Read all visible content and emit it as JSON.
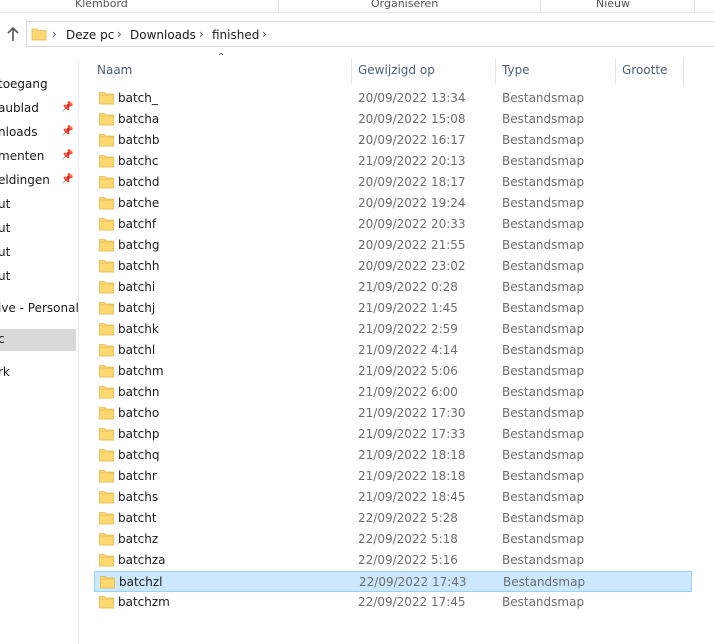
{
  "ribbon": {
    "groups": [
      "Klembord",
      "Organiseren",
      "Nieuw"
    ]
  },
  "address": {
    "crumbs": [
      "Deze pc",
      "Downloads",
      "finished"
    ]
  },
  "navpane": {
    "items": [
      {
        "label": "toegang",
        "pinned": false,
        "selected": false
      },
      {
        "label": "aublad",
        "pinned": true,
        "selected": false
      },
      {
        "label": "nloads",
        "pinned": true,
        "selected": false
      },
      {
        "label": "menten",
        "pinned": true,
        "selected": false
      },
      {
        "label": "eldingen",
        "pinned": true,
        "selected": false
      },
      {
        "label": "ut",
        "pinned": false,
        "selected": false
      },
      {
        "label": "ut",
        "pinned": false,
        "selected": false
      },
      {
        "label": "ut",
        "pinned": false,
        "selected": false
      },
      {
        "label": "ut",
        "pinned": false,
        "selected": false
      },
      {
        "label": "ive - Personal",
        "pinned": false,
        "selected": false
      },
      {
        "label": "c",
        "pinned": false,
        "selected": true
      },
      {
        "label": "rk",
        "pinned": false,
        "selected": false
      }
    ]
  },
  "columns": {
    "name": "Naam",
    "modified": "Gewijzigd op",
    "type": "Type",
    "size": "Grootte"
  },
  "files": [
    {
      "name": "batch_",
      "modified": "20/09/2022 13:34",
      "type": "Bestandsmap"
    },
    {
      "name": "batcha",
      "modified": "20/09/2022 15:08",
      "type": "Bestandsmap"
    },
    {
      "name": "batchb",
      "modified": "20/09/2022 16:17",
      "type": "Bestandsmap"
    },
    {
      "name": "batchc",
      "modified": "21/09/2022 20:13",
      "type": "Bestandsmap"
    },
    {
      "name": "batchd",
      "modified": "20/09/2022 18:17",
      "type": "Bestandsmap"
    },
    {
      "name": "batche",
      "modified": "20/09/2022 19:24",
      "type": "Bestandsmap"
    },
    {
      "name": "batchf",
      "modified": "20/09/2022 20:33",
      "type": "Bestandsmap"
    },
    {
      "name": "batchg",
      "modified": "20/09/2022 21:55",
      "type": "Bestandsmap"
    },
    {
      "name": "batchh",
      "modified": "20/09/2022 23:02",
      "type": "Bestandsmap"
    },
    {
      "name": "batchi",
      "modified": "21/09/2022 0:28",
      "type": "Bestandsmap"
    },
    {
      "name": "batchj",
      "modified": "21/09/2022 1:45",
      "type": "Bestandsmap"
    },
    {
      "name": "batchk",
      "modified": "21/09/2022 2:59",
      "type": "Bestandsmap"
    },
    {
      "name": "batchl",
      "modified": "21/09/2022 4:14",
      "type": "Bestandsmap"
    },
    {
      "name": "batchm",
      "modified": "21/09/2022 5:06",
      "type": "Bestandsmap"
    },
    {
      "name": "batchn",
      "modified": "21/09/2022 6:00",
      "type": "Bestandsmap"
    },
    {
      "name": "batcho",
      "modified": "21/09/2022 17:30",
      "type": "Bestandsmap"
    },
    {
      "name": "batchp",
      "modified": "21/09/2022 17:33",
      "type": "Bestandsmap"
    },
    {
      "name": "batchq",
      "modified": "21/09/2022 18:18",
      "type": "Bestandsmap"
    },
    {
      "name": "batchr",
      "modified": "21/09/2022 18:18",
      "type": "Bestandsmap"
    },
    {
      "name": "batchs",
      "modified": "21/09/2022 18:45",
      "type": "Bestandsmap"
    },
    {
      "name": "batcht",
      "modified": "22/09/2022 5:28",
      "type": "Bestandsmap"
    },
    {
      "name": "batchz",
      "modified": "22/09/2022 5:18",
      "type": "Bestandsmap"
    },
    {
      "name": "batchza",
      "modified": "22/09/2022 5:16",
      "type": "Bestandsmap"
    },
    {
      "name": "batchzl",
      "modified": "22/09/2022 17:43",
      "type": "Bestandsmap",
      "selected": true
    },
    {
      "name": "batchzm",
      "modified": "22/09/2022 17:45",
      "type": "Bestandsmap"
    }
  ],
  "colors": {
    "folder": "#f8d775",
    "folder_dark": "#e8b84a",
    "selection_bg": "#cce8ff",
    "selection_border": "#99d1ff",
    "nav_selected": "#d9d9d9"
  },
  "icons": {
    "up": "up-arrow-icon",
    "folder": "folder-icon",
    "pin": "pin-icon",
    "chevron": "chevron-right-icon"
  }
}
